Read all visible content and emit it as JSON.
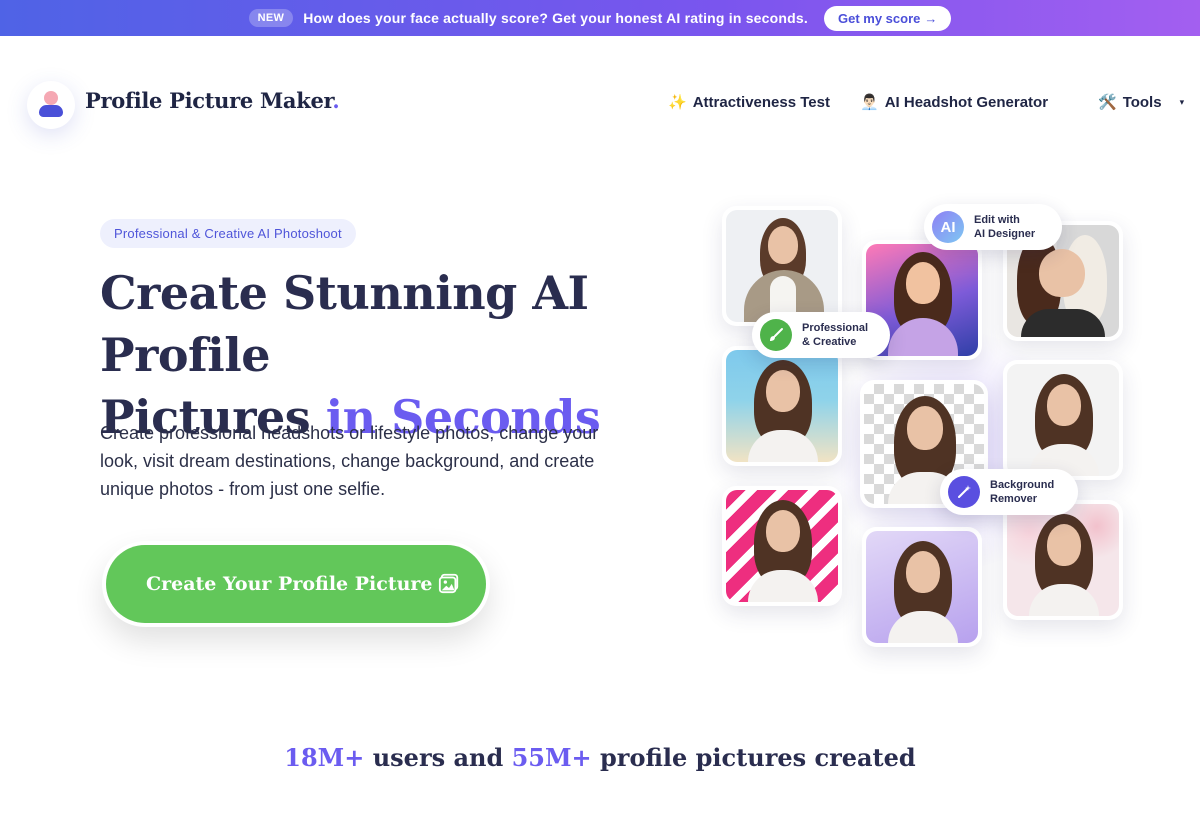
{
  "promo": {
    "badge": "NEW",
    "message": "How does your face actually score? Get your honest AI rating in seconds.",
    "cta_label": "Get my score",
    "cta_arrow": "→"
  },
  "brand": {
    "name": "Profile Picture Maker",
    "dot": "."
  },
  "nav": {
    "attractiveness": {
      "emoji": "✨",
      "label": "Attractiveness Test"
    },
    "headshot": {
      "emoji": "👨🏻‍💼",
      "label": "AI Headshot Generator"
    },
    "tools": {
      "emoji": "🛠️",
      "label": "Tools",
      "caret": "▾"
    }
  },
  "hero": {
    "pill": "Professional & Creative AI Photoshoot",
    "title_line1": "Create Stunning AI Profile",
    "title_line2_plain": "Pictures ",
    "title_line2_accent": "in Seconds",
    "description": "Create professional headshots or lifestyle photos, change your look, visit dream destinations, change background, and create unique photos - from just one selfie.",
    "cta_label": "Create Your Profile Picture"
  },
  "collage": {
    "chips": {
      "edit": {
        "icon": "AI",
        "line1": "Edit with",
        "line2": "AI Designer"
      },
      "professional": {
        "icon": "brush-icon",
        "line1": "Professional",
        "line2": "& Creative"
      },
      "background": {
        "icon": "magic-wand-icon",
        "line1": "Background",
        "line2": "Remover"
      }
    }
  },
  "stats": {
    "users": "18M+",
    "text1": " users and ",
    "pictures": "55M+",
    "text2": " profile pictures created"
  },
  "colors": {
    "accent": "#6b5cf0",
    "cta_green": "#62c75a",
    "promo_start": "#4f63e6",
    "promo_end": "#a35ff0"
  }
}
